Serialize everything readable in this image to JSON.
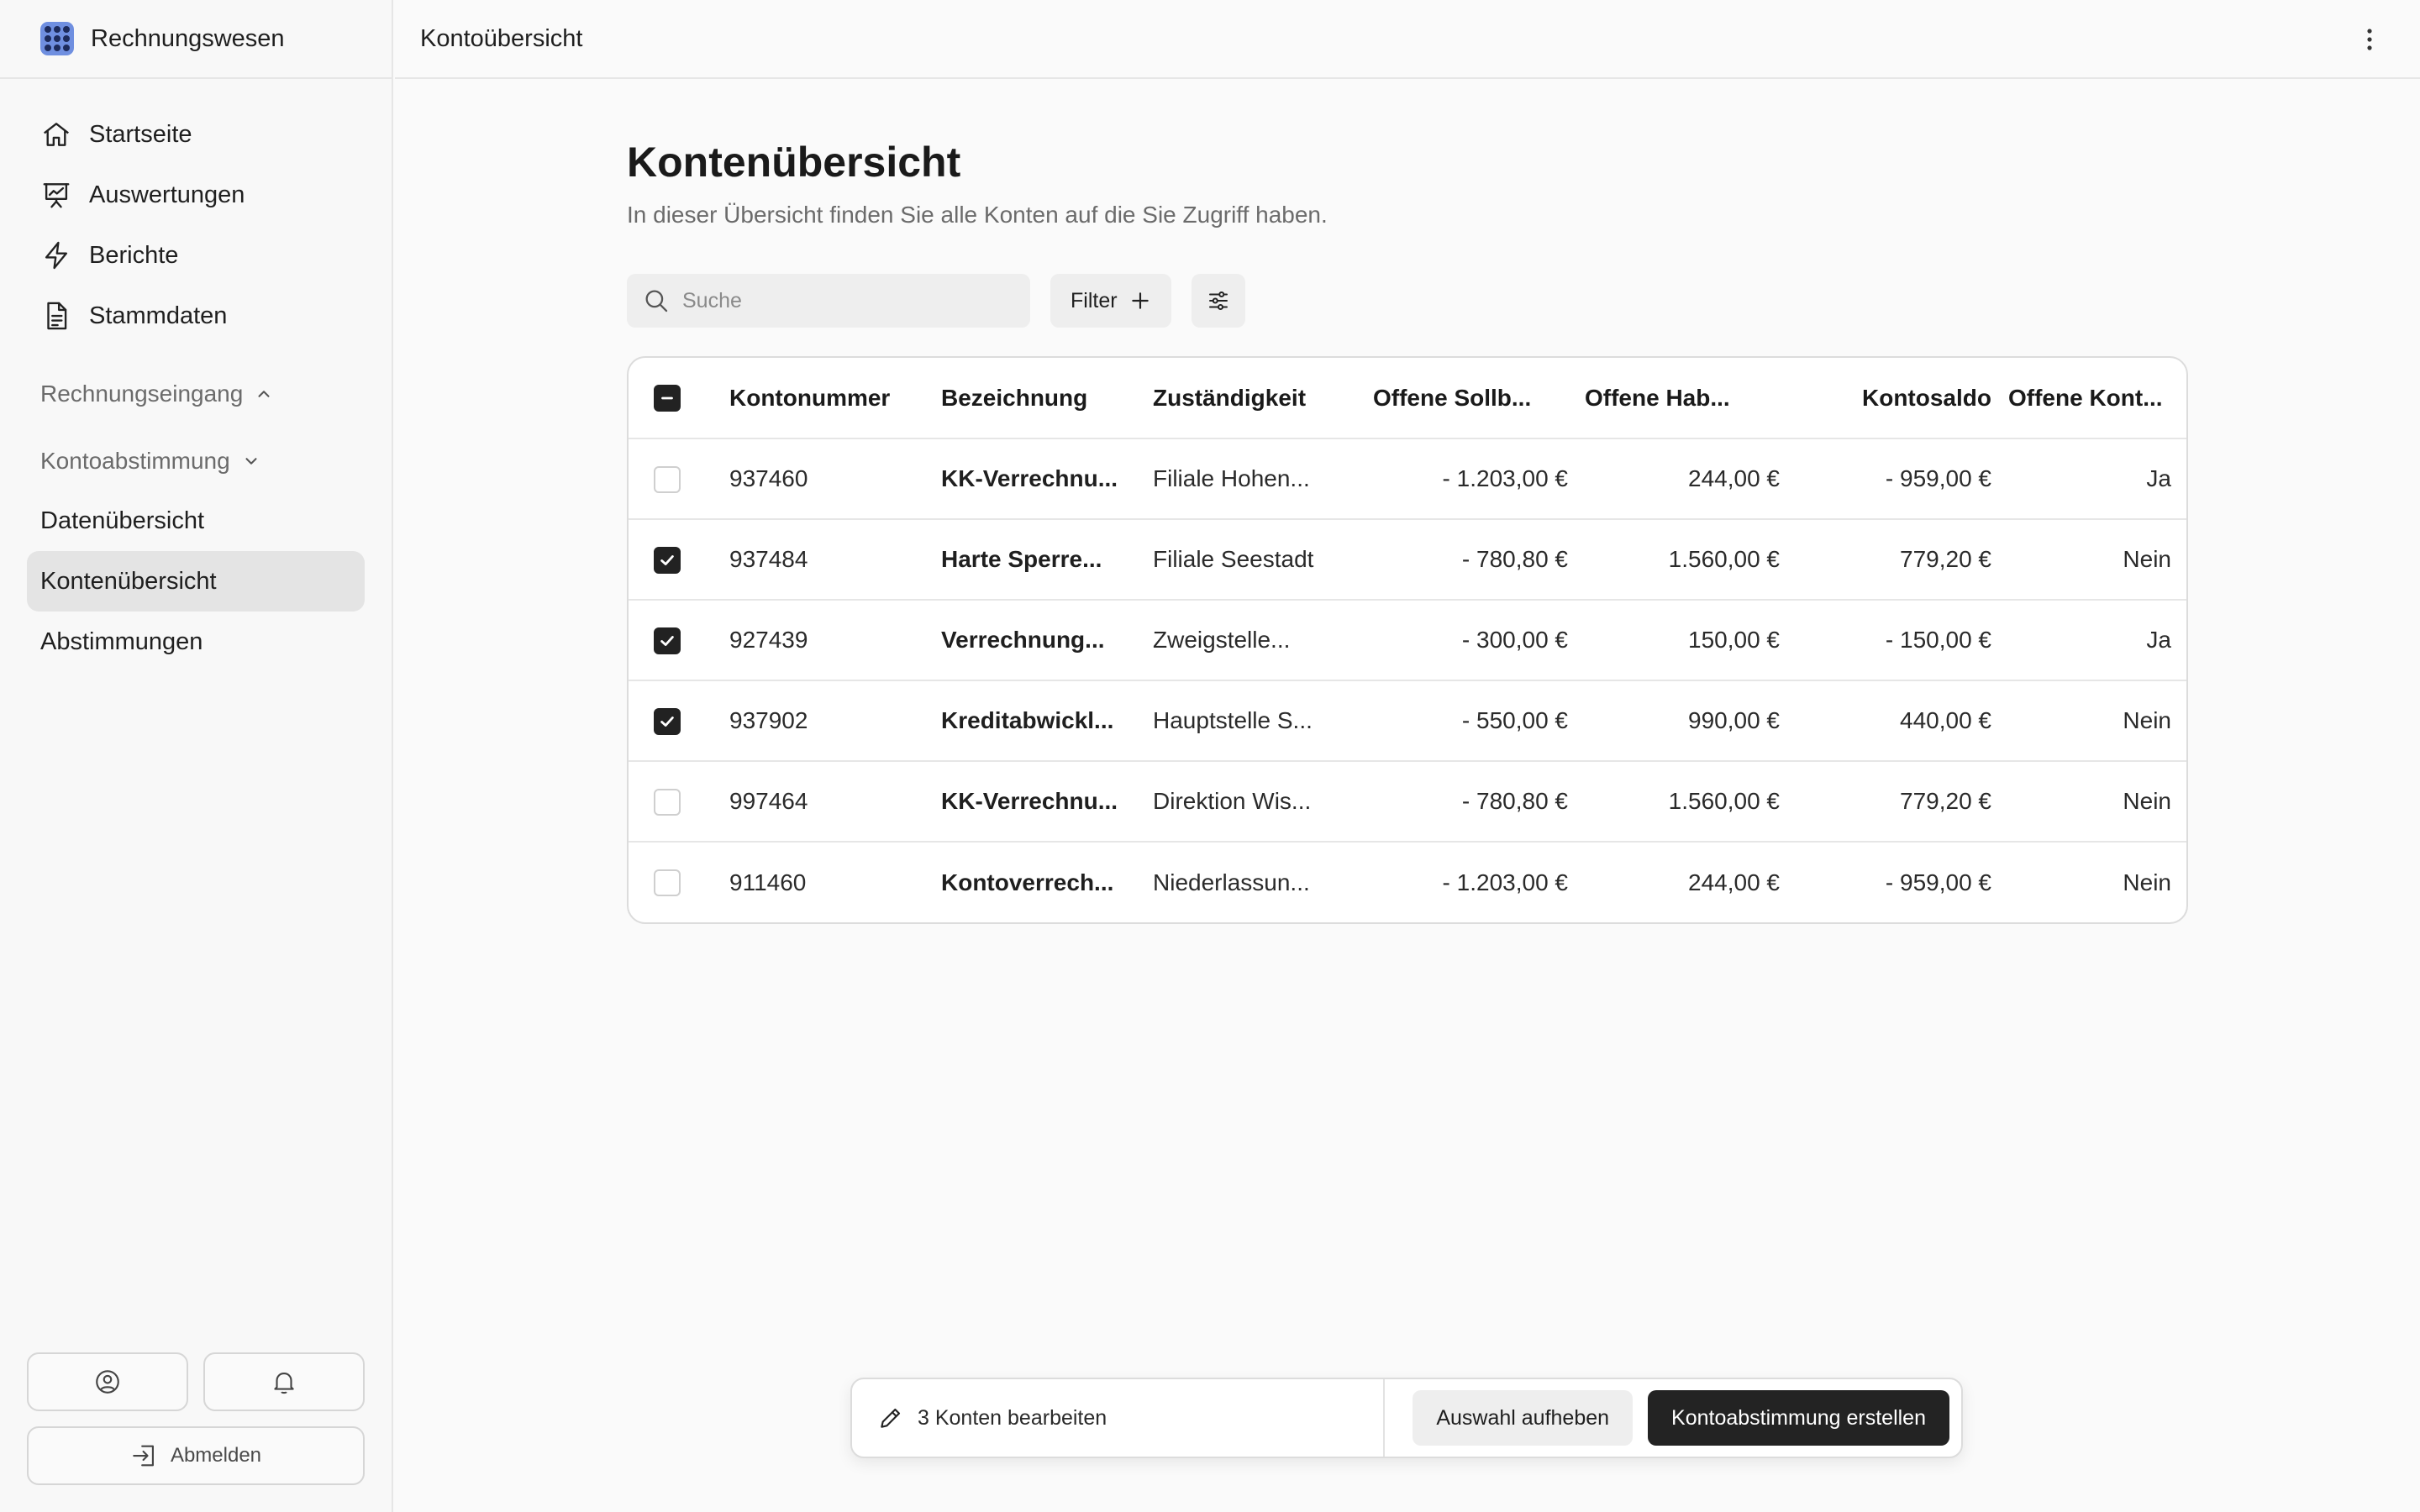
{
  "sidebar": {
    "brand": "Rechnungswesen",
    "nav": [
      {
        "label": "Startseite",
        "icon": "home-icon"
      },
      {
        "label": "Auswertungen",
        "icon": "presentation-chart-icon"
      },
      {
        "label": "Berichte",
        "icon": "lightning-icon"
      },
      {
        "label": "Stammdaten",
        "icon": "document-icon"
      }
    ],
    "section_invoice": "Rechnungseingang",
    "section_reconciliation": "Kontoabstimmung",
    "sub_items": [
      {
        "label": "Datenübersicht"
      },
      {
        "label": "Kontenübersicht",
        "active": true
      },
      {
        "label": "Abstimmungen"
      }
    ],
    "logout": "Abmelden"
  },
  "topbar": {
    "title": "Kontoübersicht"
  },
  "main": {
    "title": "Kontenübersicht",
    "description": "In dieser Übersicht finden Sie alle Konten auf die Sie Zugriff haben.",
    "search_placeholder": "Suche",
    "filter_label": "Filter"
  },
  "table": {
    "headers": [
      "Kontonummer",
      "Bezeichnung",
      "Zuständigkeit",
      "Offene Sollb...",
      "Offene Hab...",
      "Kontosaldo",
      "Offene Kont..."
    ],
    "rows": [
      {
        "checked": false,
        "number": "937460",
        "name": "KK-Verrechnu...",
        "resp": "Filiale Hohen...",
        "soll": "- 1.203,00 €",
        "haben": "244,00 €",
        "saldo": "- 959,00 €",
        "open": "Ja"
      },
      {
        "checked": true,
        "number": "937484",
        "name": "Harte Sperre...",
        "resp": "Filiale Seestadt",
        "soll": "- 780,80 €",
        "haben": "1.560,00 €",
        "saldo": "779,20 €",
        "open": "Nein"
      },
      {
        "checked": true,
        "number": "927439",
        "name": "Verrechnung...",
        "resp": "Zweigstelle...",
        "soll": "- 300,00 €",
        "haben": "150,00 €",
        "saldo": "- 150,00 €",
        "open": "Ja"
      },
      {
        "checked": true,
        "number": "937902",
        "name": "Kreditabwickl...",
        "resp": "Hauptstelle S...",
        "soll": "- 550,00 €",
        "haben": "990,00 €",
        "saldo": "440,00 €",
        "open": "Nein"
      },
      {
        "checked": false,
        "number": "997464",
        "name": "KK-Verrechnu...",
        "resp": "Direktion Wis...",
        "soll": "- 780,80 €",
        "haben": "1.560,00 €",
        "saldo": "779,20 €",
        "open": "Nein"
      },
      {
        "checked": false,
        "number": "911460",
        "name": "Kontoverrech...",
        "resp": "Niederlassun...",
        "soll": "- 1.203,00 €",
        "haben": "244,00 €",
        "saldo": "- 959,00 €",
        "open": "Nein"
      }
    ]
  },
  "action_bar": {
    "edit_label": "3 Konten bearbeiten",
    "clear_label": "Auswahl aufheben",
    "create_label": "Kontoabstimmung erstellen"
  },
  "colors": {
    "brand": "#6f8fe0",
    "primary_button": "#232323",
    "active_nav": "#e4e4e4"
  }
}
